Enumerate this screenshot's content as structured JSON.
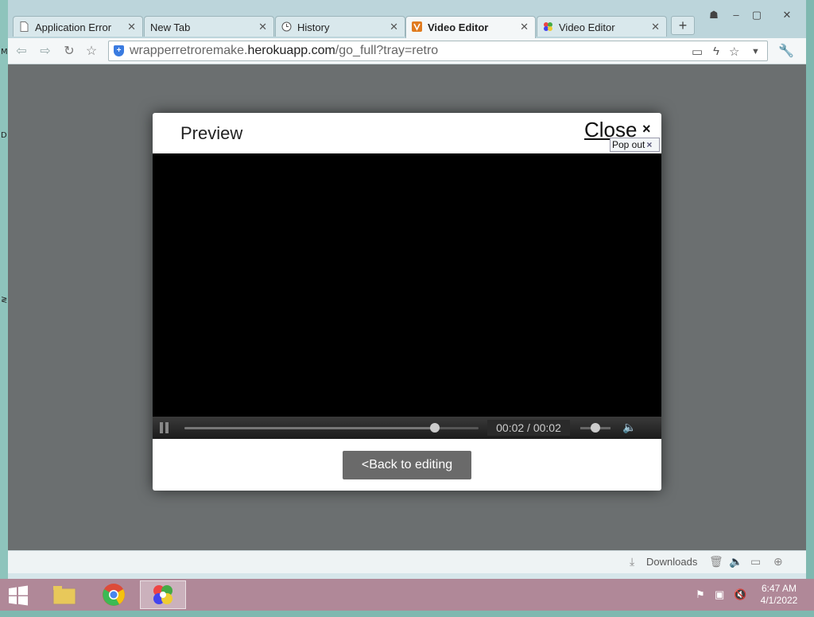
{
  "browser": {
    "tabs": [
      {
        "label": "Application Error",
        "icon": "page-icon"
      },
      {
        "label": "New Tab",
        "icon": "none"
      },
      {
        "label": "History",
        "icon": "history-clock-icon"
      },
      {
        "label": "Video Editor",
        "icon": "video-editor-v-icon",
        "active": true
      },
      {
        "label": "Video Editor",
        "icon": "colorful-flower-icon"
      }
    ],
    "new_tab_symbol": "+",
    "url_prefix": "wrapperretroremake.",
    "url_domain": "herokuapp.com",
    "url_path": "/go_full?tray=retro"
  },
  "modal": {
    "title": "Preview",
    "close_label": "Close",
    "close_symbol": "×",
    "popout_label": "Pop out",
    "popout_symbol": "×",
    "player": {
      "time_display": "00:02 / 00:02",
      "progress_fraction": 0.85,
      "volume_fraction": 0.5
    },
    "back_button_label": "<Back to editing"
  },
  "statusbar": {
    "downloads_label": "Downloads"
  },
  "taskbar": {
    "time": "6:47 AM",
    "date": "4/1/2022"
  },
  "colors": {
    "accent_tab_icon": "#e07b1f",
    "back_button": "#6a6a6a",
    "taskbar": "#b08898"
  }
}
